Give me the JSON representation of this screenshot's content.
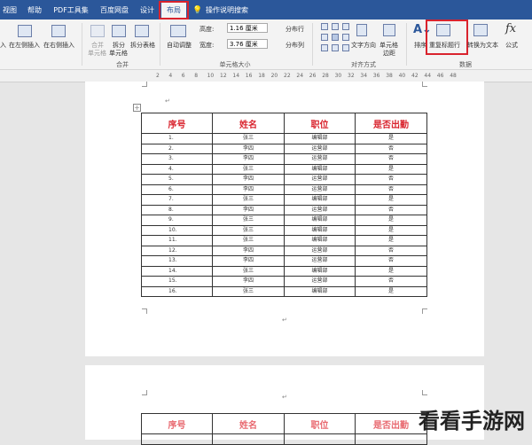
{
  "tabs": [
    {
      "label": "视图"
    },
    {
      "label": "帮助"
    },
    {
      "label": "PDF工具集"
    },
    {
      "label": "百度网盘"
    },
    {
      "label": "设计"
    },
    {
      "label": "布局"
    }
  ],
  "tell_me": "操作说明搜索",
  "ribbon": {
    "insert_left": "在左侧插入",
    "insert_right": "在右侧插入",
    "insert_left_cut": "入",
    "merge_cells_1": "合并",
    "merge_cells_2": "单元格",
    "split_cells_1": "拆分",
    "split_cells_2": "单元格",
    "split_table": "拆分表格",
    "merge_group": "合并",
    "autofit": "自动调整",
    "height_label": "高度:",
    "height_value": "1.16 厘米",
    "width_label": "宽度:",
    "width_value": "3.76 厘米",
    "distribute_rows": "分布行",
    "distribute_cols": "分布列",
    "cellsize_group": "单元格大小",
    "text_direction": "文字方向",
    "cell_margins_1": "单元格",
    "cell_margins_2": "边距",
    "align_group": "对齐方式",
    "sort": "排序",
    "repeat_header": "重复标题行",
    "convert_text": "转换为文本",
    "formula": "公式",
    "data_group": "数据"
  },
  "ruler_ticks": [
    "2",
    "4",
    "6",
    "8",
    "10",
    "12",
    "14",
    "16",
    "18",
    "20",
    "22",
    "24",
    "26",
    "28",
    "30",
    "32",
    "34",
    "36",
    "38",
    "40",
    "42",
    "44",
    "46",
    "48"
  ],
  "table": {
    "headers": [
      "序号",
      "姓名",
      "职位",
      "是否出勤"
    ],
    "rows": [
      [
        "1.",
        "张三",
        "编辑部",
        "是"
      ],
      [
        "2.",
        "李四",
        "运营部",
        "否"
      ],
      [
        "3.",
        "李四",
        "运营部",
        "否"
      ],
      [
        "4.",
        "张三",
        "编辑部",
        "是"
      ],
      [
        "5.",
        "李四",
        "运营部",
        "否"
      ],
      [
        "6.",
        "李四",
        "运营部",
        "否"
      ],
      [
        "7.",
        "张三",
        "编辑部",
        "是"
      ],
      [
        "8.",
        "李四",
        "运营部",
        "否"
      ],
      [
        "9.",
        "张三",
        "编辑部",
        "是"
      ],
      [
        "10.",
        "张三",
        "编辑部",
        "是"
      ],
      [
        "11.",
        "张三",
        "编辑部",
        "是"
      ],
      [
        "12.",
        "李四",
        "运营部",
        "否"
      ],
      [
        "13.",
        "李四",
        "运营部",
        "否"
      ],
      [
        "14.",
        "张三",
        "编辑部",
        "是"
      ],
      [
        "15.",
        "李四",
        "运营部",
        "否"
      ],
      [
        "16.",
        "张三",
        "编辑部",
        "是"
      ]
    ]
  },
  "table2_headers": [
    "序号",
    "姓名",
    "职位",
    "是否出勤"
  ],
  "para_mark": "↵",
  "watermark": "看看手游网"
}
